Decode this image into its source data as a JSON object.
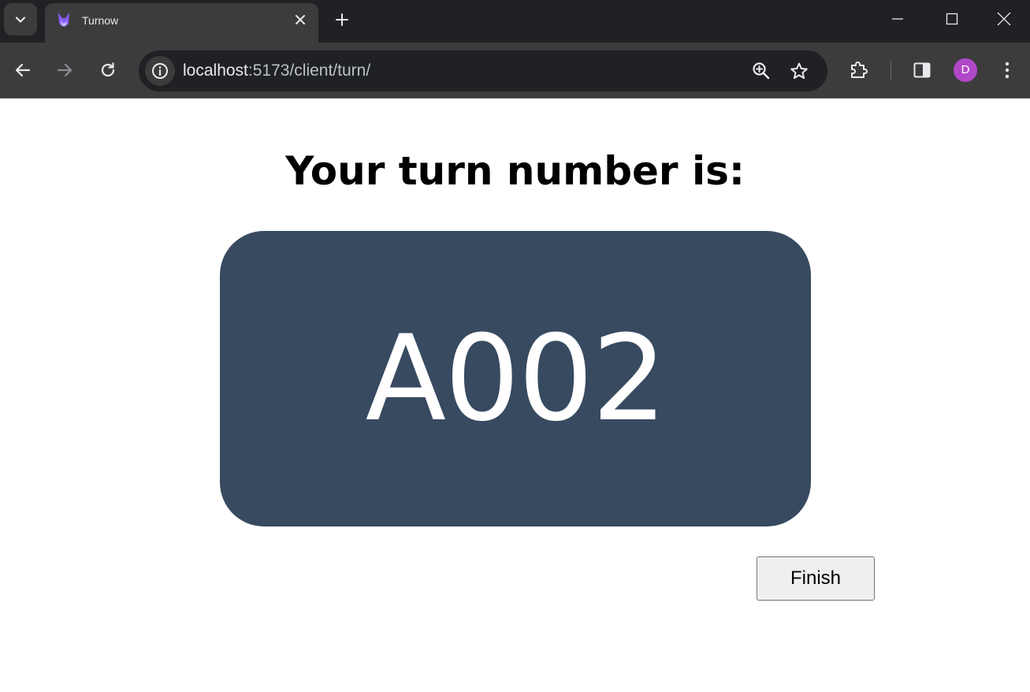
{
  "browser": {
    "tab": {
      "title": "Turnow",
      "close_icon": "close-icon"
    },
    "address_bar": {
      "host": "localhost",
      "path": ":5173/client/turn/"
    },
    "profile_initial": "D",
    "colors": {
      "tabbar_bg": "#202124",
      "toolbar_bg": "#3c3c3c",
      "avatar_bg": "#b048c7"
    }
  },
  "page": {
    "heading": "Your turn number is:",
    "turn_number": "A002",
    "finish_label": "Finish",
    "colors": {
      "card_bg": "#374a60",
      "turn_text": "#ffffff"
    }
  }
}
